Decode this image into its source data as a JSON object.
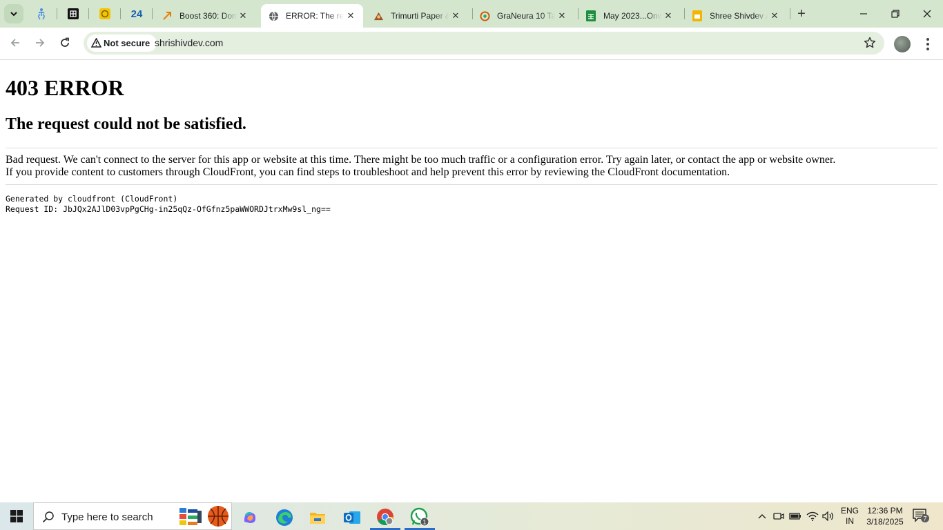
{
  "browser": {
    "tabs": [
      {
        "title": "Boost 360: Dom",
        "favicon": "boost-icon"
      },
      {
        "title": "ERROR: The req",
        "favicon": "globe-icon",
        "active": true
      },
      {
        "title": "Trimurti Paper &",
        "favicon": "trimurti-icon"
      },
      {
        "title": "GraNeura 10 Ta",
        "favicon": "graneura-icon"
      },
      {
        "title": "May 2023...Onw",
        "favicon": "sheets-icon"
      },
      {
        "title": "Shree Shivdev A",
        "favicon": "slides-icon"
      }
    ],
    "pinned_tab_number": "24",
    "security_label": "Not secure",
    "url": "shrishivdev.com"
  },
  "page": {
    "heading": "403 ERROR",
    "subheading": "The request could not be satisfied.",
    "paragraph_line1": "Bad request. We can't connect to the server for this app or website at this time. There might be too much traffic or a configuration error. Try again later, or contact the app or website owner.",
    "paragraph_line2": "If you provide content to customers through CloudFront, you can find steps to troubleshoot and help prevent this error by reviewing the CloudFront documentation.",
    "generated_by": "Generated by cloudfront (CloudFront)",
    "request_id": "Request ID: JbJQx2AJlD03vpPgCHg-in25qQz-OfGfnz5paWWORDJtrxMw9sl_ng=="
  },
  "taskbar": {
    "search_placeholder": "Type here to search",
    "whatsapp_badge": "1",
    "language": "ENG",
    "region": "IN",
    "time": "12:36 PM",
    "date": "3/18/2025",
    "notification_count": "7"
  },
  "colors": {
    "tab_strip": "#d5e6cf",
    "omnibox": "#e5efe0",
    "taskbar_accent": "#2b6cc4"
  }
}
